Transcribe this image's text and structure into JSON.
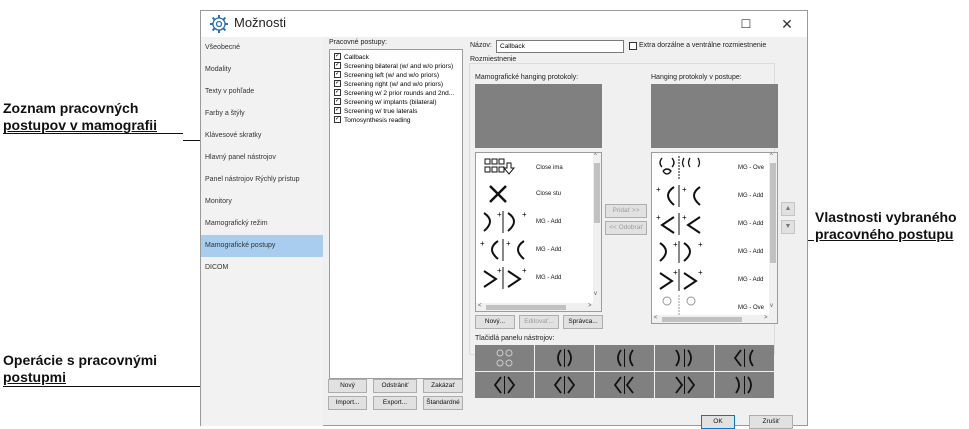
{
  "annotations": {
    "left_top": [
      "Zoznam pracovných",
      "postupov v mamografii"
    ],
    "left_bottom": [
      "Operácie s pracovnými",
      "postupmi"
    ],
    "right": [
      "Vlastnosti vybraného",
      "pracovného postupu"
    ]
  },
  "window": {
    "title": "Možnosti",
    "maximize": "☐",
    "close": "✕"
  },
  "sidebar": {
    "items": [
      {
        "label": "Všeobecné"
      },
      {
        "label": "Modality"
      },
      {
        "label": "Texty v pohľade"
      },
      {
        "label": "Farby a štýly"
      },
      {
        "label": "Klávesové skratky"
      },
      {
        "label": "Hlavný panel nástrojov"
      },
      {
        "label": "Panel nástrojov Rýchly prístup"
      },
      {
        "label": "Monitory"
      },
      {
        "label": "Mamografický režim"
      },
      {
        "label": "Mamografické postupy"
      },
      {
        "label": "DICOM"
      }
    ],
    "selected_index": 9
  },
  "workflows": {
    "label": "Pracovné postupy:",
    "items": [
      {
        "label": "Callback",
        "checked": true
      },
      {
        "label": "Screening bilateral (w/ and w/o priors)",
        "checked": true
      },
      {
        "label": "Screening left (w/ and w/o priors)",
        "checked": true
      },
      {
        "label": "Screening right (w/ and w/o priors)",
        "checked": true
      },
      {
        "label": "Screening w/ 2 prior rounds and 2nd...",
        "checked": true
      },
      {
        "label": "Screening w/ implants (bilateral)",
        "checked": true
      },
      {
        "label": "Screening w/ true laterals",
        "checked": true
      },
      {
        "label": "Tomosynthesis reading",
        "checked": true
      }
    ],
    "buttons": {
      "new": "Nový",
      "remove": "Odstrániť",
      "disable": "Zakázať",
      "import": "Import...",
      "export": "Export...",
      "standard": "Štandardné"
    }
  },
  "details": {
    "name_label": "Názov:",
    "name_value": "Callback",
    "extra_label": "Extra dorzálne a ventrálne rozmiestnenie",
    "layout_group": "Rozmiestnenie",
    "mammo_protocols_label": "Mamografické hanging protokoly:",
    "workflow_protocols_label": "Hanging protokoly v postupe:",
    "available_items": [
      "Close ima",
      "Close stu",
      "MG - Add",
      "MG - Add",
      "MG - Add"
    ],
    "workflow_items": [
      "MG - Ove",
      "MG - Add",
      "MG - Add",
      "MG - Add",
      "MG - Add",
      "MG - Ove"
    ],
    "add_btn": "Pridať >>",
    "remove_btn": "<< Odobrať",
    "new_btn": "Nový...",
    "edit_btn": "Editovať...",
    "manage_btn": "Správca...",
    "toolbar_label": "Tlačidlá panelu nástrojov:",
    "move_up": "▲",
    "move_down": "▼"
  },
  "footer": {
    "ok": "OK",
    "cancel": "Zrušiť"
  },
  "colors": {
    "selected": "#a8cdee",
    "preview_gray": "#808080",
    "window_bg": "#f0f0f0"
  }
}
